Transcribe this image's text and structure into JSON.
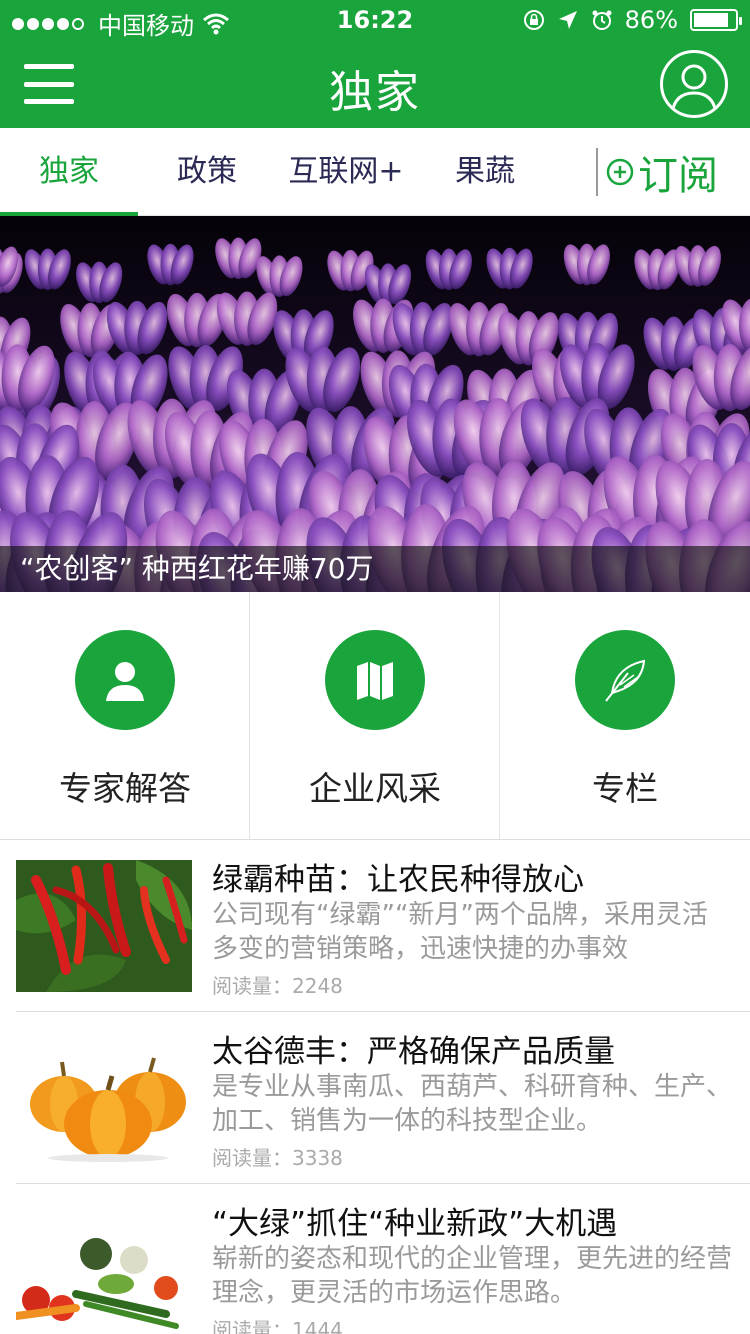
{
  "status_bar": {
    "carrier": "中国移动",
    "time": "16:22",
    "battery": "86%",
    "battery_level": 0.86
  },
  "header": {
    "title": "独家",
    "menu_icon": "hamburger-menu-icon",
    "profile_icon": "user-avatar-icon"
  },
  "tabs": [
    {
      "label": "独家",
      "active": true
    },
    {
      "label": "政策",
      "active": false
    },
    {
      "label": "互联网+",
      "active": false
    },
    {
      "label": "果蔬",
      "active": false
    }
  ],
  "subscribe": {
    "label": "订阅",
    "icon": "plus-circle-icon"
  },
  "banner": {
    "caption": "“农创客” 种西红花年赚70万"
  },
  "categories": [
    {
      "label": "专家解答",
      "icon": "person-icon"
    },
    {
      "label": "企业风采",
      "icon": "map-icon"
    },
    {
      "label": "专栏",
      "icon": "feather-icon"
    }
  ],
  "news": [
    {
      "title": "绿霸种苗：让农民种得放心",
      "desc": "公司现有“绿霸”“新月”两个品牌，采用灵活多变的营销策略，迅速快捷的办事效",
      "reads_label": "阅读量：",
      "reads": "2248"
    },
    {
      "title": "太谷德丰：严格确保产品质量",
      "desc": "是专业从事南瓜、西葫芦、科研育种、生产、加工、销售为一体的科技型企业。",
      "reads_label": "阅读量：",
      "reads": "3338"
    },
    {
      "title": "“大绿”抓住“种业新政”大机遇",
      "desc": "崭新的姿态和现代的企业管理，更先进的经营理念，更灵活的市场运作思路。",
      "reads_label": "阅读量：",
      "reads": "1444"
    }
  ],
  "colors": {
    "brand": "#1aa53c",
    "tab_text": "#2a2a55",
    "muted": "#9a9a9a"
  }
}
